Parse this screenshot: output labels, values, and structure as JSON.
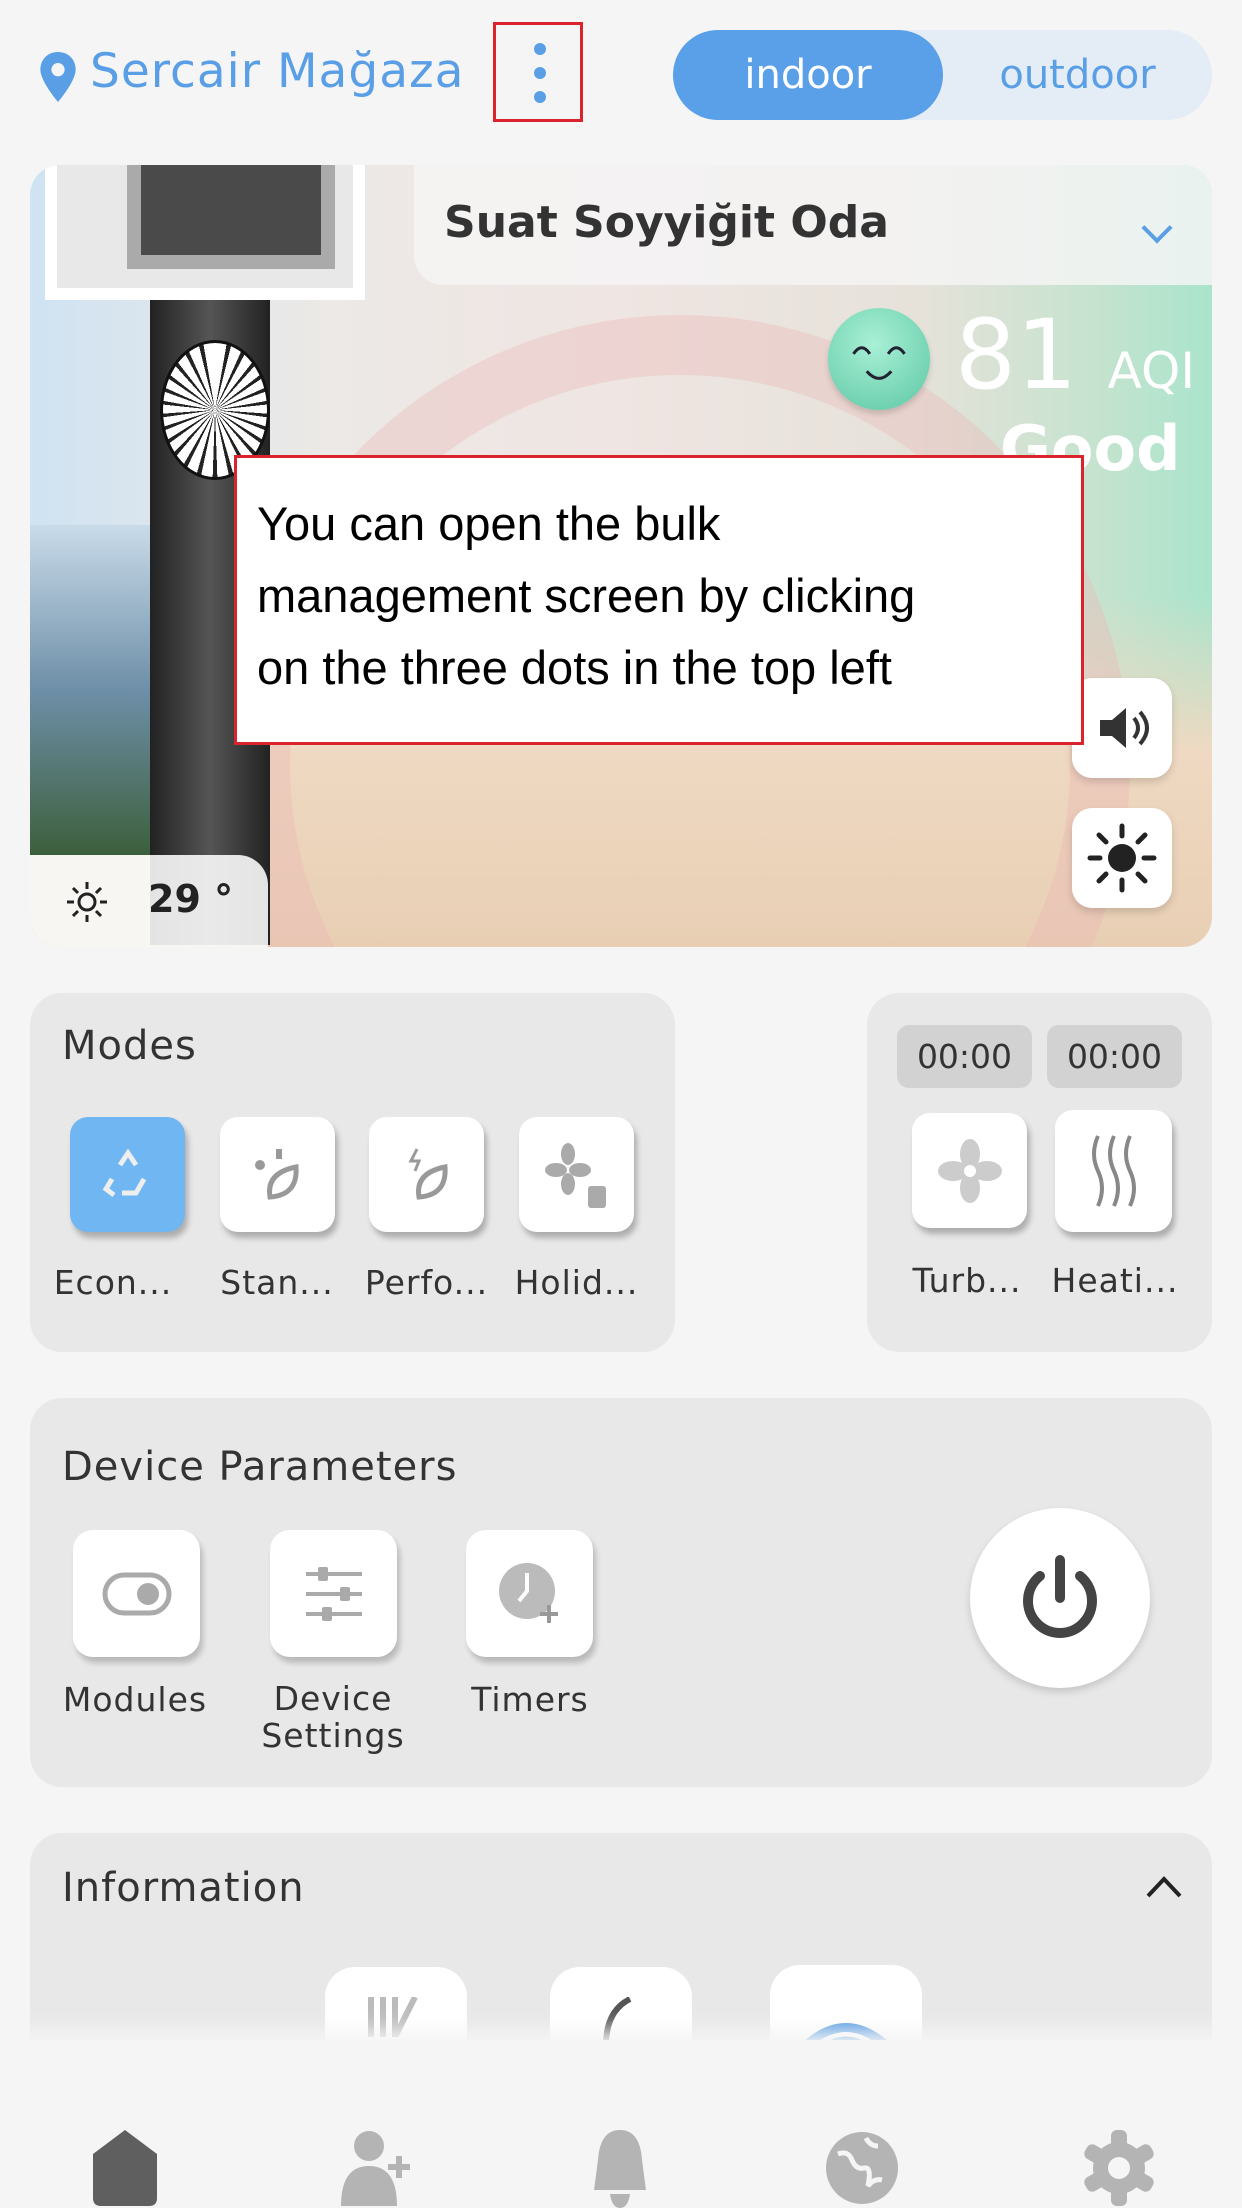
{
  "header": {
    "location": "Sercair Mağaza",
    "more_icon": "three-dots-vertical-icon",
    "toggle": {
      "options": [
        "indoor",
        "outdoor"
      ],
      "selected": "indoor"
    }
  },
  "hero": {
    "room": "Suat Soyyiğit Oda",
    "aqi_value": "81",
    "aqi_unit": "AQI",
    "aqi_status": "Good",
    "temperature": "29 °",
    "face_icon": "smiling-face-icon"
  },
  "tooltip": {
    "lines": [
      "You can open the bulk",
      "management screen by clicking",
      "on the three dots in the top left"
    ]
  },
  "modes": {
    "title": "Modes",
    "items": [
      {
        "label": "Econ...",
        "icon": "recycle-icon",
        "active": true
      },
      {
        "label": "Stan...",
        "icon": "leaf-icon",
        "active": false
      },
      {
        "label": "Perfo...",
        "icon": "leaf-bolt-icon",
        "active": false
      },
      {
        "label": "Holid...",
        "icon": "fan-luggage-icon",
        "active": false
      }
    ]
  },
  "timers_panel": {
    "items": [
      {
        "time": "00:00",
        "label": "Turb...",
        "icon": "fan-icon"
      },
      {
        "time": "00:00",
        "label": "Heati...",
        "icon": "heat-waves-icon"
      }
    ]
  },
  "device_parameters": {
    "title": "Device Parameters",
    "items": [
      {
        "label": "Modules",
        "icon": "toggle-icon"
      },
      {
        "label": "Device Settings",
        "icon": "sliders-icon"
      },
      {
        "label": "Timers",
        "icon": "clock-plus-icon"
      }
    ],
    "power_icon": "power-icon"
  },
  "information": {
    "title": "Information"
  },
  "nav": [
    {
      "name": "home",
      "icon": "home-icon",
      "active": true
    },
    {
      "name": "add-user",
      "icon": "user-plus-icon"
    },
    {
      "name": "notifications",
      "icon": "bell-icon"
    },
    {
      "name": "globe",
      "icon": "globe-icon"
    },
    {
      "name": "settings",
      "icon": "gear-icon"
    }
  ],
  "colors": {
    "accent": "#5aa0e8",
    "tooltip_border": "#d9232d",
    "card_bg": "#e8e8e8"
  }
}
